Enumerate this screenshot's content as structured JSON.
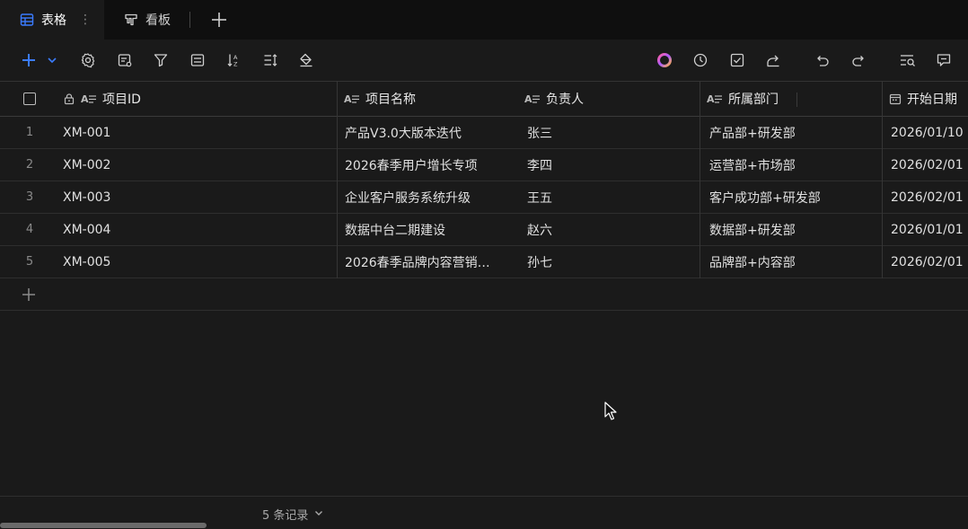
{
  "tabs": [
    {
      "label": "表格",
      "active": true
    },
    {
      "label": "看板",
      "active": false
    }
  ],
  "tab_more_glyph": "⋮",
  "toolbar": {
    "left_icons": [
      "add-icon",
      "chevron-down-icon",
      "settings-icon",
      "form-icon",
      "filter-icon",
      "group-icon",
      "sort-icon",
      "row-height-icon",
      "paint-icon"
    ],
    "right_icons": [
      "ai-icon",
      "history-icon",
      "task-icon",
      "share-icon",
      "undo-icon",
      "redo-icon",
      "search-icon",
      "comment-icon"
    ]
  },
  "columns": [
    {
      "label": "项目ID",
      "icon": "text-field-icon",
      "locked": true
    },
    {
      "label": "项目名称",
      "icon": "text-field-icon"
    },
    {
      "label": "负责人",
      "icon": "text-field-icon"
    },
    {
      "label": "所属部门",
      "icon": "text-field-icon"
    },
    {
      "label": "开始日期",
      "icon": "date-field-icon"
    }
  ],
  "rows": [
    {
      "num": "1",
      "id": "XM-001",
      "name": "产品V3.0大版本迭代",
      "owner": "张三",
      "dept": "产品部+研发部",
      "start": "2026/01/10"
    },
    {
      "num": "2",
      "id": "XM-002",
      "name": "2026春季用户增长专项",
      "owner": "李四",
      "dept": "运营部+市场部",
      "start": "2026/02/01"
    },
    {
      "num": "3",
      "id": "XM-003",
      "name": "企业客户服务系统升级",
      "owner": "王五",
      "dept": "客户成功部+研发部",
      "start": "2026/02/01"
    },
    {
      "num": "4",
      "id": "XM-004",
      "name": "数据中台二期建设",
      "owner": "赵六",
      "dept": "数据部+研发部",
      "start": "2026/01/01"
    },
    {
      "num": "5",
      "id": "XM-005",
      "name": "2026春季品牌内容营销…",
      "owner": "孙七",
      "dept": "品牌部+内容部",
      "start": "2026/02/01"
    }
  ],
  "footer": {
    "record_count": "5 条记录"
  },
  "colors": {
    "accent": "#3b7cff",
    "background": "#1a1a1a",
    "tabbar": "#0f0f0f"
  }
}
